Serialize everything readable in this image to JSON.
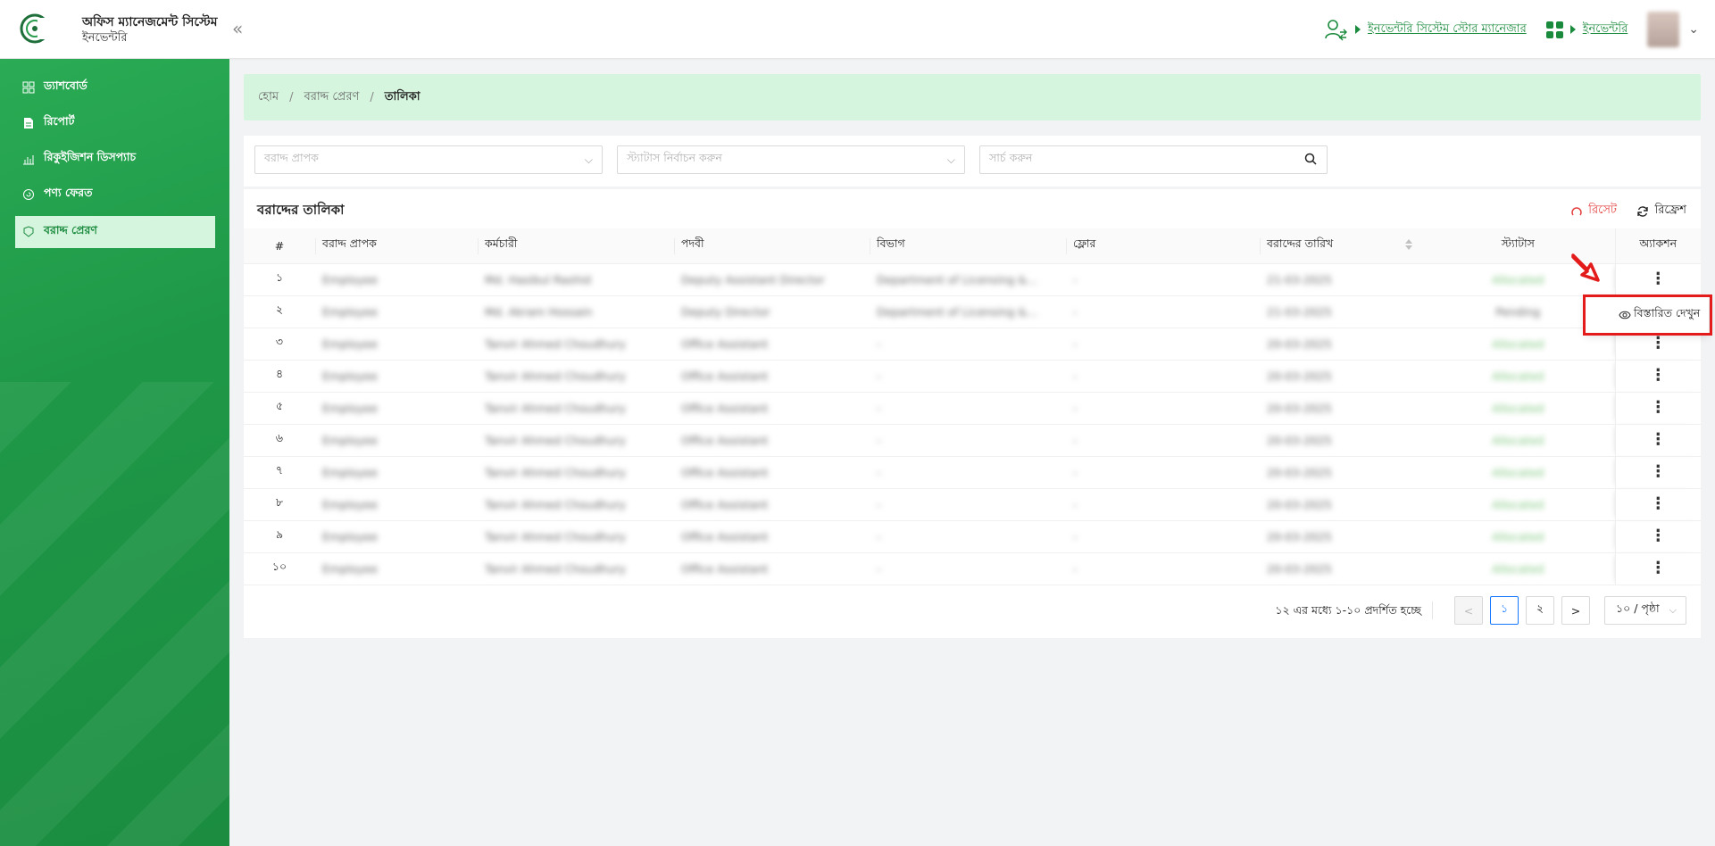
{
  "header": {
    "app_title": "অফিস ম্যানেজমেন্ট সিস্টেম",
    "app_subtitle": "ইনভেন্টরি",
    "collapse_glyph": "«",
    "role_link": "ইনভেন্টরি সিস্টেম স্টোর ম্যানেজার",
    "module_link": "ইনভেন্টরি"
  },
  "sidebar": {
    "items": [
      {
        "label": "ড্যাশবোর্ড",
        "icon": "dashboard-icon"
      },
      {
        "label": "রিপোর্ট",
        "icon": "report-icon"
      },
      {
        "label": "রিকুইজিশন ডিসপ্যাচ",
        "icon": "dispatch-icon"
      },
      {
        "label": "পণ্য ফেরত",
        "icon": "return-icon"
      },
      {
        "label": "বরাদ্দ প্রেরণ",
        "icon": "allocation-icon",
        "active": true
      }
    ]
  },
  "breadcrumb": {
    "home": "হোম",
    "section": "বরাদ্দ প্রেরণ",
    "current": "তালিকা",
    "separator": "/"
  },
  "filters": {
    "recipient_placeholder": "বরাদ্দ প্রাপক",
    "status_placeholder": "স্ট্যাটাস নির্বাচন করুন",
    "search_placeholder": "সার্চ করুন"
  },
  "table_panel": {
    "title": "বরাদ্দের তালিকা",
    "reset_label": "রিসেট",
    "refresh_label": "রিফ্রেশ",
    "columns": [
      "#",
      "বরাদ্দ প্রাপক",
      "কর্মচারী",
      "পদবী",
      "বিভাগ",
      "ফ্লোর",
      "বরাদ্দের তারিখ",
      "স্ট্যাটাস",
      "অ্যাকশন"
    ],
    "rows": [
      {
        "idx": "১",
        "recipient": "Employee",
        "employee": "Md. Hasibul Rashid",
        "designation": "Deputy Assistant Director",
        "department": "Department of Licensing &...",
        "floor": "-",
        "date": "21-03-2025",
        "status": "Allocated"
      },
      {
        "idx": "২",
        "recipient": "Employee",
        "employee": "Md. Akram Hossain",
        "designation": "Deputy Director",
        "department": "Department of Licensing &...",
        "floor": "-",
        "date": "21-03-2025",
        "status": "Pending"
      },
      {
        "idx": "৩",
        "recipient": "Employee",
        "employee": "Tanvir Ahmed Choudhury",
        "designation": "Office Assistant",
        "department": "-",
        "floor": "-",
        "date": "20-03-2025",
        "status": "Allocated"
      },
      {
        "idx": "৪",
        "recipient": "Employee",
        "employee": "Tanvir Ahmed Choudhury",
        "designation": "Office Assistant",
        "department": "-",
        "floor": "-",
        "date": "20-03-2025",
        "status": "Allocated"
      },
      {
        "idx": "৫",
        "recipient": "Employee",
        "employee": "Tanvir Ahmed Choudhury",
        "designation": "Office Assistant",
        "department": "-",
        "floor": "-",
        "date": "20-03-2025",
        "status": "Allocated"
      },
      {
        "idx": "৬",
        "recipient": "Employee",
        "employee": "Tanvir Ahmed Choudhury",
        "designation": "Office Assistant",
        "department": "-",
        "floor": "-",
        "date": "20-03-2025",
        "status": "Allocated"
      },
      {
        "idx": "৭",
        "recipient": "Employee",
        "employee": "Tanvir Ahmed Choudhury",
        "designation": "Office Assistant",
        "department": "-",
        "floor": "-",
        "date": "20-03-2025",
        "status": "Allocated"
      },
      {
        "idx": "৮",
        "recipient": "Employee",
        "employee": "Tanvir Ahmed Choudhury",
        "designation": "Office Assistant",
        "department": "-",
        "floor": "-",
        "date": "20-03-2025",
        "status": "Allocated"
      },
      {
        "idx": "৯",
        "recipient": "Employee",
        "employee": "Tanvir Ahmed Choudhury",
        "designation": "Office Assistant",
        "department": "-",
        "floor": "-",
        "date": "20-03-2025",
        "status": "Allocated"
      },
      {
        "idx": "১০",
        "recipient": "Employee",
        "employee": "Tanvir Ahmed Choudhury",
        "designation": "Office Assistant",
        "department": "-",
        "floor": "-",
        "date": "20-03-2025",
        "status": "Allocated"
      }
    ],
    "action_glyph": "⋮"
  },
  "pagination": {
    "info": "১২ এর মধ্যে ১-১০ প্রদর্শিত হচ্ছে",
    "prev": "<",
    "next": ">",
    "pages": [
      "১",
      "২"
    ],
    "current_page": "১",
    "page_size": "১০ / পৃষ্ঠা"
  },
  "dropdown": {
    "view_details": "বিস্তারিত দেখুন"
  },
  "colors": {
    "brand_green": "#1a8a3d",
    "sidebar_active_bg": "#d6f5df",
    "reset_red": "#e23a3a",
    "highlight_red": "#e31b1b"
  }
}
